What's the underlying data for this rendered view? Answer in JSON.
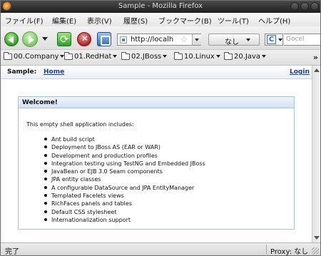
{
  "window": {
    "title": "Sample - Mozilla Firefox"
  },
  "menu": {
    "items": [
      {
        "label": "ファイル(F)"
      },
      {
        "label": "編集(E)"
      },
      {
        "label": "表示(V)"
      },
      {
        "label": "履歴(S)"
      },
      {
        "label": "ブックマーク(B)"
      },
      {
        "label": "ツール(T)"
      },
      {
        "label": "ヘルプ(H)"
      }
    ]
  },
  "navbar": {
    "url": "http://localh",
    "bookmark_dropdown": "なし",
    "search_engine_icon": "C",
    "search_placeholder": "Gocel"
  },
  "bookmarks": {
    "items": [
      {
        "label": "00.Company"
      },
      {
        "label": "01.RedHat"
      },
      {
        "label": "02.JBoss"
      },
      {
        "label": "10.Linux"
      },
      {
        "label": "20.Java"
      }
    ],
    "overflow": "»"
  },
  "page": {
    "header": {
      "brand": "Sample:",
      "home": "Home",
      "login": "Login"
    },
    "panel": {
      "title": "Welcome!",
      "intro": "This empty shell application includes:",
      "features": [
        "Ant build script",
        "Deployment to JBoss AS (EAR or WAR)",
        "Development and production profiles",
        "Integration testing using TestNG and Embedded JBoss",
        "JavaBean or EJB 3.0 Seam components",
        "JPA entity classes",
        "A configurable DataSource and JPA EntityManager",
        "Templated Facelets views",
        "RichFaces panels and tables",
        "Default CSS stylesheet",
        "Internationalization support"
      ]
    }
  },
  "status": {
    "text": "完了",
    "proxy": "Proxy: なし"
  },
  "colors": {
    "link": "#1b3e9c",
    "panel_border": "#a8c0e0",
    "titlebar": "#2e2e2e"
  }
}
